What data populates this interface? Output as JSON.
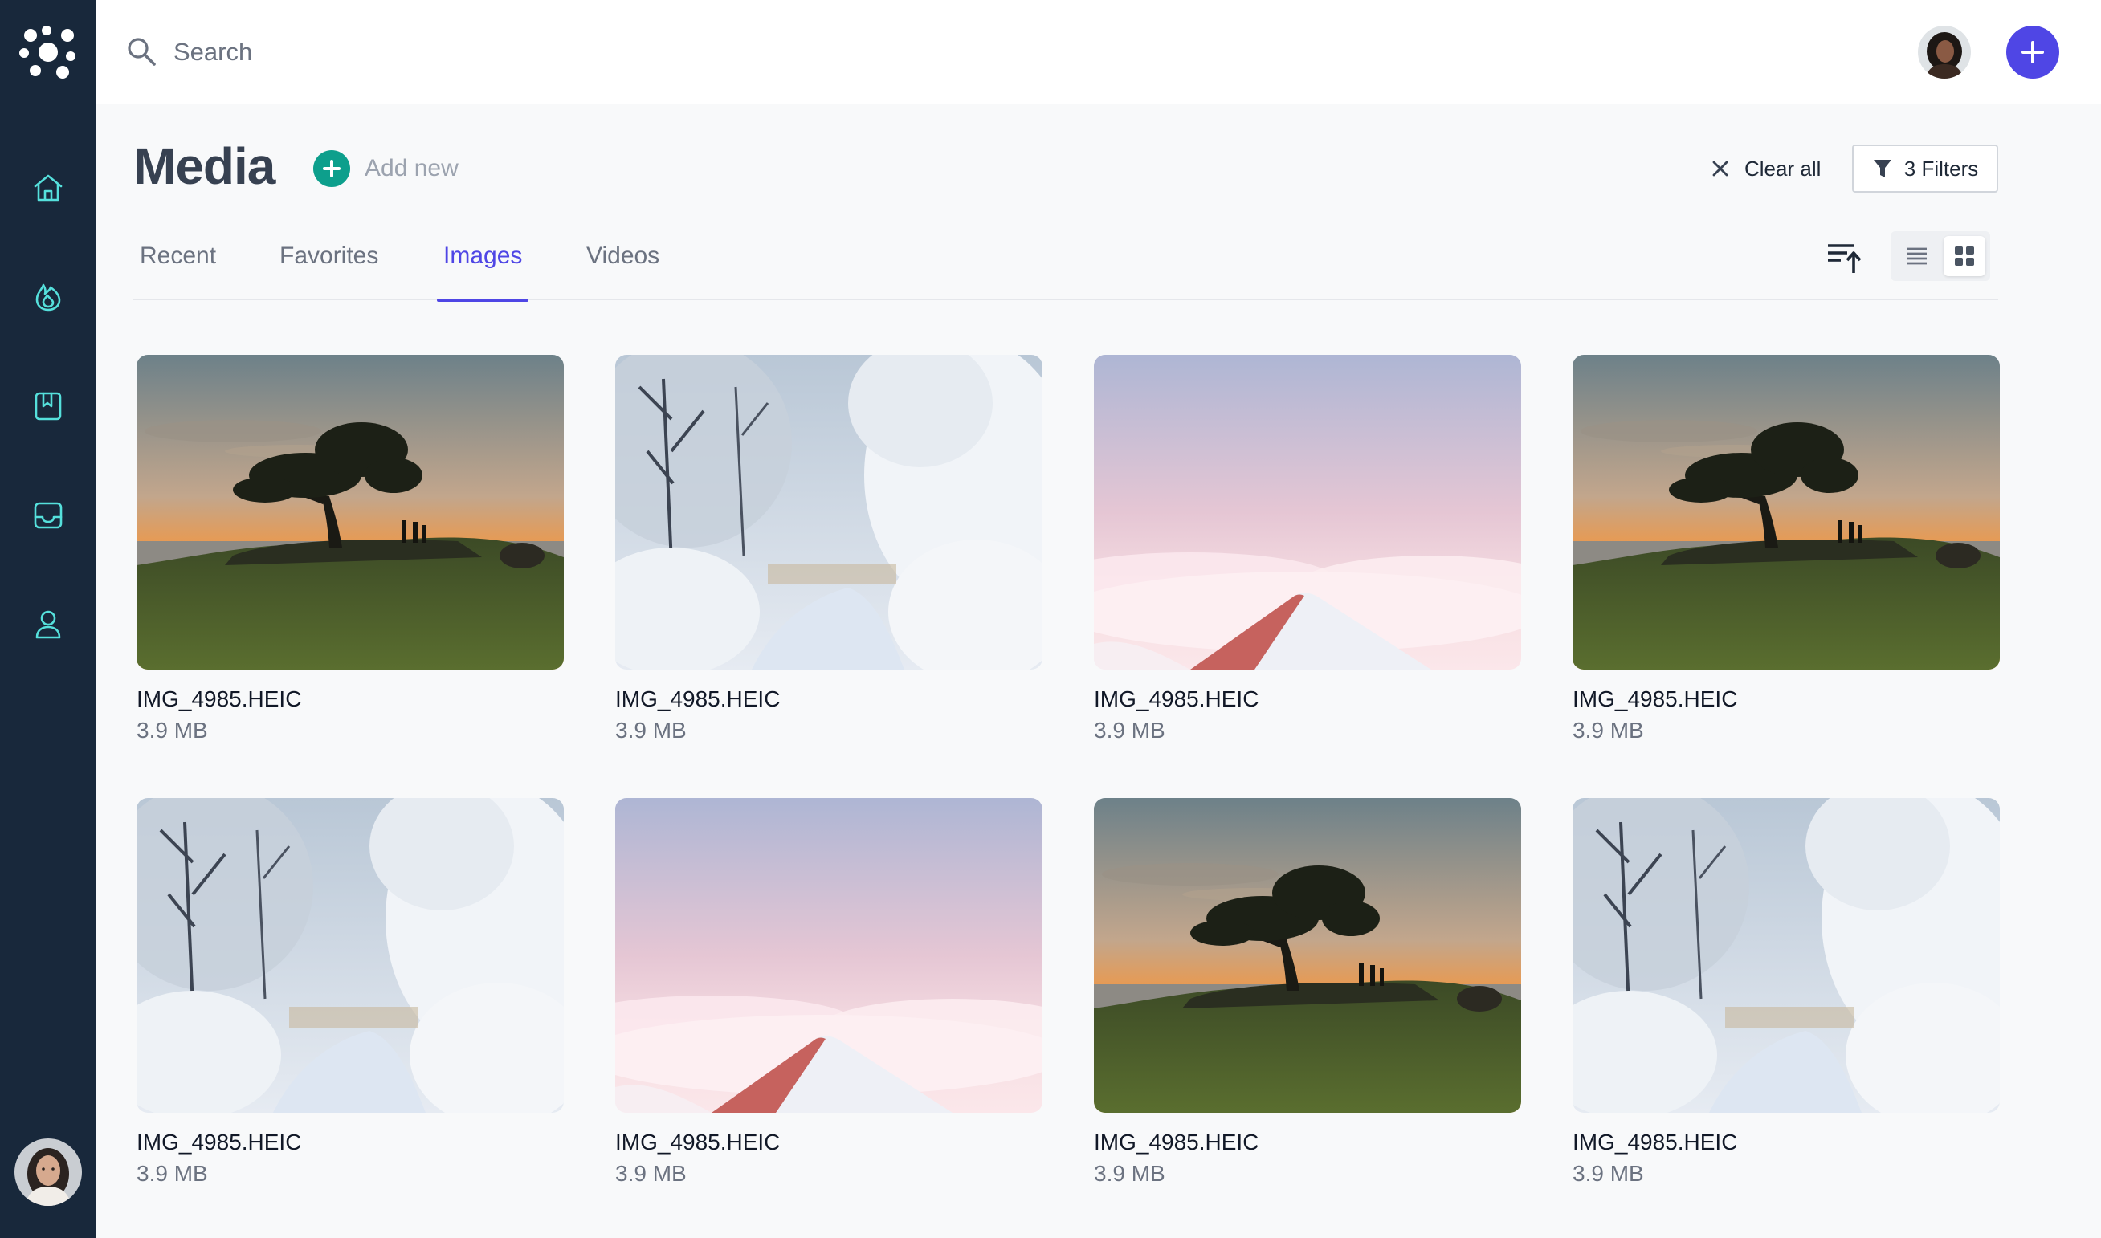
{
  "search": {
    "placeholder": "Search"
  },
  "sidebar": {
    "items": [
      {
        "name": "home",
        "icon": "home-icon"
      },
      {
        "name": "trending",
        "icon": "flame-icon"
      },
      {
        "name": "bookmarks",
        "icon": "bookmark-icon"
      },
      {
        "name": "inbox",
        "icon": "inbox-icon"
      },
      {
        "name": "profile",
        "icon": "user-icon"
      }
    ],
    "accent": "#55e0dc",
    "background": "#18283b"
  },
  "header": {
    "title": "Media",
    "add_new_label": "Add new",
    "clear_all_label": "Clear all",
    "filters_label": "3 Filters"
  },
  "tabs": [
    {
      "label": "Recent",
      "active": false
    },
    {
      "label": "Favorites",
      "active": false
    },
    {
      "label": "Images",
      "active": true
    },
    {
      "label": "Videos",
      "active": false
    }
  ],
  "view_mode": "grid",
  "media": [
    {
      "name": "IMG_4985.HEIC",
      "size": "3.9 MB",
      "scene": "tree-sunset"
    },
    {
      "name": "IMG_4985.HEIC",
      "size": "3.9 MB",
      "scene": "snowy-forest"
    },
    {
      "name": "IMG_4985.HEIC",
      "size": "3.9 MB",
      "scene": "snowy-peak"
    },
    {
      "name": "IMG_4985.HEIC",
      "size": "3.9 MB",
      "scene": "tree-sunset"
    },
    {
      "name": "IMG_4985.HEIC",
      "size": "3.9 MB",
      "scene": "snowy-forest"
    },
    {
      "name": "IMG_4985.HEIC",
      "size": "3.9 MB",
      "scene": "snowy-peak"
    },
    {
      "name": "IMG_4985.HEIC",
      "size": "3.9 MB",
      "scene": "tree-sunset"
    },
    {
      "name": "IMG_4985.HEIC",
      "size": "3.9 MB",
      "scene": "snowy-forest"
    }
  ],
  "colors": {
    "primary": "#4f46e5",
    "add_new": "#0d9f8c"
  }
}
